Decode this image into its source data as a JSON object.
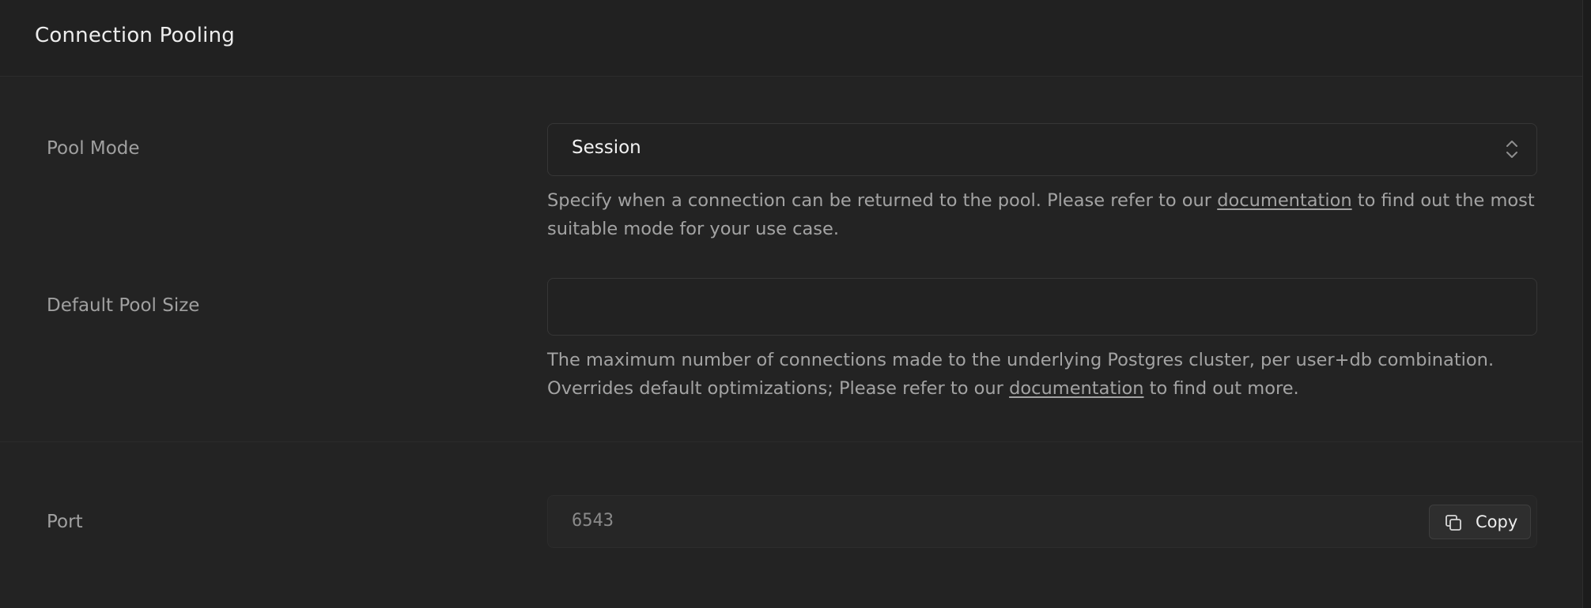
{
  "panel": {
    "title": "Connection Pooling"
  },
  "pool_mode": {
    "label": "Pool Mode",
    "selected": "Session",
    "help_before": "Specify when a connection can be returned to the pool. Please refer to our ",
    "help_link": "documentation",
    "help_after": " to find out the most suitable mode for your use case."
  },
  "pool_size": {
    "label": "Default Pool Size",
    "value": "",
    "help_before": "The maximum number of connections made to the underlying Postgres cluster, per user+db combination. Overrides default optimizations; Please refer to our ",
    "help_link": "documentation",
    "help_after": " to find out more."
  },
  "port": {
    "label": "Port",
    "value": "6543",
    "copy_label": "Copy"
  },
  "icons": {
    "select": "chevron-up-down-icon",
    "copy": "copy-icon"
  }
}
